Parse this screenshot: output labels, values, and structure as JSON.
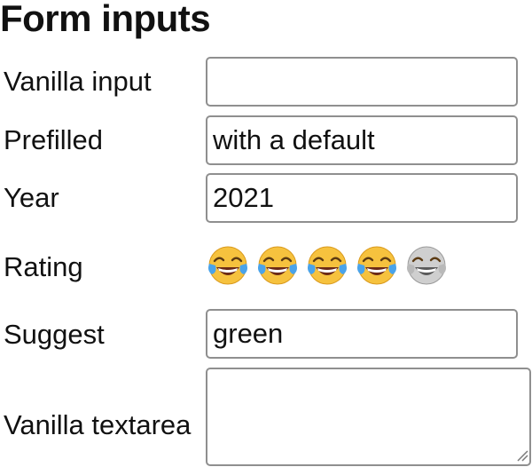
{
  "page": {
    "title": "Form inputs"
  },
  "fields": {
    "vanilla_input": {
      "label": "Vanilla input",
      "value": "",
      "placeholder": ""
    },
    "prefilled": {
      "label": "Prefilled",
      "value": "with a default"
    },
    "year": {
      "label": "Year",
      "value": "2021"
    },
    "rating": {
      "label": "Rating",
      "value": 4,
      "max": 5,
      "icon": "tears-of-joy-emoji-icon"
    },
    "suggest": {
      "label": "Suggest",
      "value": "green"
    },
    "vanilla_textarea": {
      "label": "Vanilla textarea",
      "value": ""
    }
  },
  "colors": {
    "border": "#8f8f8f",
    "emoji_face": "#f6c23e",
    "emoji_tear": "#4aa3ea",
    "emoji_off": "#cfcfcf"
  }
}
